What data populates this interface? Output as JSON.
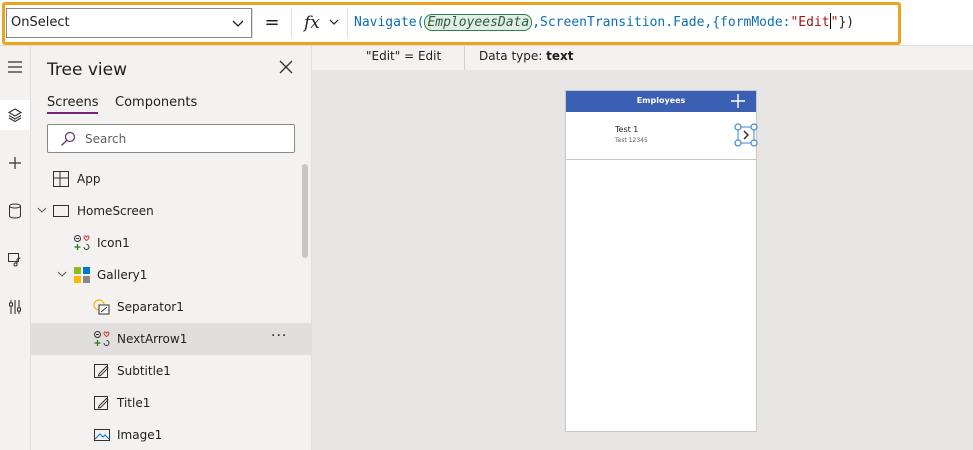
{
  "formula_bar": {
    "property": "OnSelect",
    "equals": "=",
    "fx": "fx",
    "formula": {
      "fn": "Navigate(",
      "arg1": "EmployeesData",
      "mid": ",ScreenTransition.Fade,{formMode:",
      "str": "\"Edit",
      "str_end": "\"",
      "end": "})"
    }
  },
  "intellisense": {
    "result": "\"Edit\"  =  Edit",
    "datatype_label": "Data type: ",
    "datatype_value": "text"
  },
  "tree": {
    "title": "Tree view",
    "tabs": [
      "Screens",
      "Components"
    ],
    "search_placeholder": "Search",
    "items": [
      {
        "label": "App"
      },
      {
        "label": "HomeScreen"
      },
      {
        "label": "Icon1"
      },
      {
        "label": "Gallery1"
      },
      {
        "label": "Separator1"
      },
      {
        "label": "NextArrow1"
      },
      {
        "label": "Subtitle1"
      },
      {
        "label": "Title1"
      },
      {
        "label": "Image1"
      }
    ],
    "more": "···"
  },
  "preview": {
    "header": "Employees",
    "item_title": "Test 1",
    "item_subtitle": "Test 12345"
  },
  "colors": {
    "highlight_border": "#f0a21c",
    "header_blue": "#3b5fb3",
    "selection_blue": "#3f86d1"
  }
}
